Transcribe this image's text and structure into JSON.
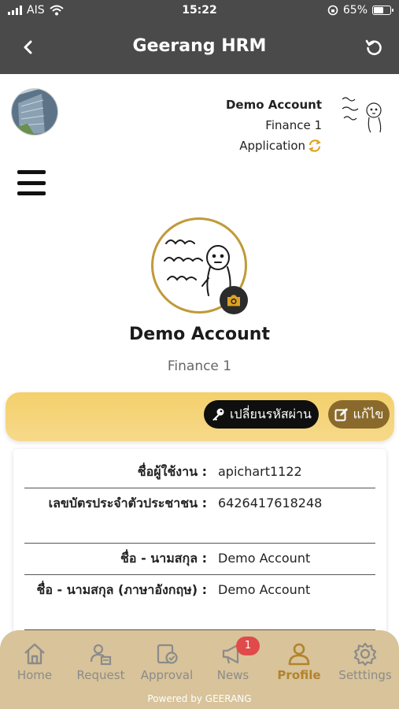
{
  "status_bar": {
    "carrier": "AIS",
    "time": "15:22",
    "battery": "65%",
    "battery_level": 0.65
  },
  "header": {
    "title": "Geerang HRM",
    "back_icon": "chevron-left-icon",
    "refresh_icon": "refresh-icon"
  },
  "account": {
    "name": "Demo Account",
    "department": "Finance 1",
    "app_label": "Application"
  },
  "profile": {
    "name": "Demo Account",
    "department": "Finance 1"
  },
  "actions": {
    "change_password": "เปลี่ยนรหัสผ่าน",
    "edit": "แก้ไข"
  },
  "info": [
    {
      "label": "ชื่อผู้ใช้งาน :",
      "value": "apichart1122"
    },
    {
      "label": "เลขบัตรประจำตัวประชาชน :",
      "value": "6426417618248"
    },
    {
      "label": "ชื่อ - นามสกุล :",
      "value": "Demo Account"
    },
    {
      "label": "ชื่อ - นามสกุล (ภาษาอังกฤษ) :",
      "value": "Demo Account"
    }
  ],
  "nav": {
    "items": [
      {
        "label": "Home",
        "icon": "home-icon"
      },
      {
        "label": "Request",
        "icon": "request-icon"
      },
      {
        "label": "Approval",
        "icon": "approval-icon"
      },
      {
        "label": "News",
        "icon": "news-icon",
        "badge": "1"
      },
      {
        "label": "Profile",
        "icon": "profile-icon",
        "active": true
      },
      {
        "label": "Setttings",
        "icon": "gear-icon"
      }
    ]
  },
  "footer": {
    "powered_by": "Powered by GEERANG"
  },
  "colors": {
    "header_bg": "#4a4a4a",
    "accent_gold": "#c09a3a",
    "action_bar": "#f4d06b",
    "nav_bg": "#d8c39a",
    "active_nav": "#b3832b",
    "badge": "#e04a4a"
  }
}
